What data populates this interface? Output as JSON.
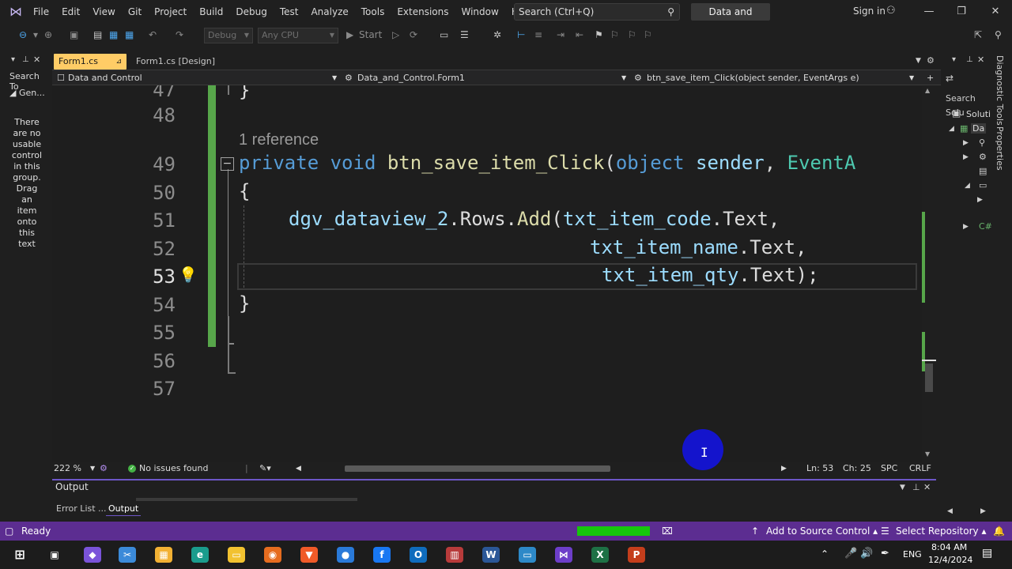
{
  "menubar": {
    "items": [
      "File",
      "Edit",
      "View",
      "Git",
      "Project",
      "Build",
      "Debug",
      "Test",
      "Analyze",
      "Tools",
      "Extensions",
      "Window",
      "Help"
    ],
    "search_placeholder": "Search (Ctrl+Q)",
    "solution_name": "Data and Control",
    "sign_in": "Sign in"
  },
  "toolbar": {
    "config": "Debug",
    "platform": "Any CPU",
    "start_label": "Start"
  },
  "toolbox": {
    "search_label": "Search To",
    "group_label": "Gen...",
    "empty_text": "There are no usable control in this group. Drag an item onto this text"
  },
  "tabs": {
    "active": "Form1.cs",
    "inactive": "Form1.cs [Design]"
  },
  "navbar": {
    "project": "Data and Control",
    "class": "Data_and_Control.Form1",
    "member": "btn_save_item_Click(object sender, EventArgs e)"
  },
  "editor": {
    "line_numbers": [
      "47",
      "48",
      "49",
      "50",
      "51",
      "52",
      "53",
      "54",
      "55",
      "56",
      "57"
    ],
    "current_line": "53",
    "reference_text": "1 reference",
    "line49_parts": [
      "private",
      "void",
      "btn_save_item_Click",
      "(",
      "object",
      "sender",
      ",",
      "EventA"
    ],
    "line50": "{",
    "line51": "dgv_dataview_2.Rows.Add(txt_item_code.Text,",
    "line52": "txt_item_name.Text,",
    "line53": "txt_item_qty.Text);",
    "line54": "}",
    "line47": "}"
  },
  "status_strip": {
    "zoom": "222 %",
    "issues": "No issues found",
    "ln": "Ln: 53",
    "ch": "Ch: 25",
    "spc": "SPC",
    "crlf": "CRLF"
  },
  "output": {
    "title": "Output",
    "tabs": [
      "Error List ...",
      "Output"
    ]
  },
  "solution_explorer": {
    "search_label": "Search Solu",
    "items": [
      "Soluti",
      "Da"
    ]
  },
  "side_tabs": [
    "Diagnostic Tools",
    "Properties"
  ],
  "statusbar": {
    "ready": "Ready",
    "source_control": "Add to Source Control",
    "repository": "Select Repository"
  },
  "taskbar": {
    "lang": "ENG",
    "time": "8:04 AM",
    "date": "12/4/2024"
  },
  "colors": {
    "accent": "#5c2d91",
    "tab_active": "#ffcc66",
    "keyword": "#569cd6",
    "method": "#dcdcaa",
    "type": "#4ec9b0",
    "param": "#9cdcfe",
    "change_bar": "#57a64a"
  }
}
